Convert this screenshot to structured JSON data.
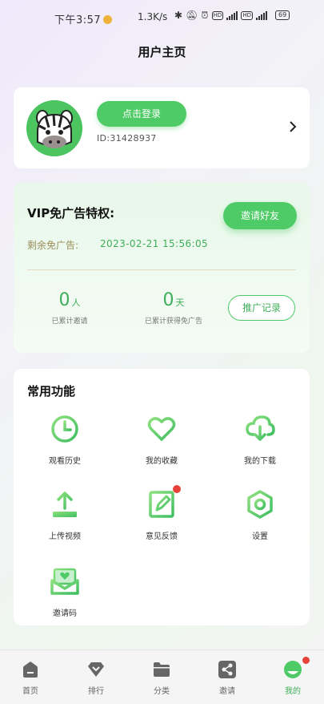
{
  "status_bar": {
    "time": "下午3:57",
    "speed": "1.3K/s",
    "hd1": "HD",
    "hd2": "HD",
    "net1": "5G",
    "net2": "4G",
    "battery": "69"
  },
  "page_title": "用户主页",
  "profile": {
    "login_label": "点击登录",
    "user_id": "ID:31428937"
  },
  "vip": {
    "title": "VIP免广告特权:",
    "invite_button": "邀请好友",
    "remaining_label": "剩余免广告:",
    "remaining_value": "2023-02-21 15:56:05",
    "people_count": "0",
    "people_unit": "人",
    "people_label": "已累计邀请",
    "days_count": "0",
    "days_unit": "天",
    "days_label": "已累计获得免广告",
    "record_button": "推广记录"
  },
  "functions": {
    "title": "常用功能",
    "items": [
      {
        "label": "观看历史",
        "icon": "clock-icon"
      },
      {
        "label": "我的收藏",
        "icon": "heart-icon"
      },
      {
        "label": "我的下载",
        "icon": "cloud-download-icon"
      },
      {
        "label": "上传视频",
        "icon": "upload-icon"
      },
      {
        "label": "意见反馈",
        "icon": "edit-note-icon"
      },
      {
        "label": "设置",
        "icon": "settings-icon"
      },
      {
        "label": "邀请码",
        "icon": "envelope-heart-icon"
      }
    ]
  },
  "tabs": [
    {
      "label": "首页",
      "icon": "home-icon"
    },
    {
      "label": "排行",
      "icon": "diamond-icon"
    },
    {
      "label": "分类",
      "icon": "folder-icon"
    },
    {
      "label": "邀请",
      "icon": "share-icon"
    },
    {
      "label": "我的",
      "icon": "profile-face-icon"
    }
  ],
  "colors": {
    "accent": "#4ecb66",
    "accent_text": "#3fae5a",
    "badge": "#e8413a"
  }
}
